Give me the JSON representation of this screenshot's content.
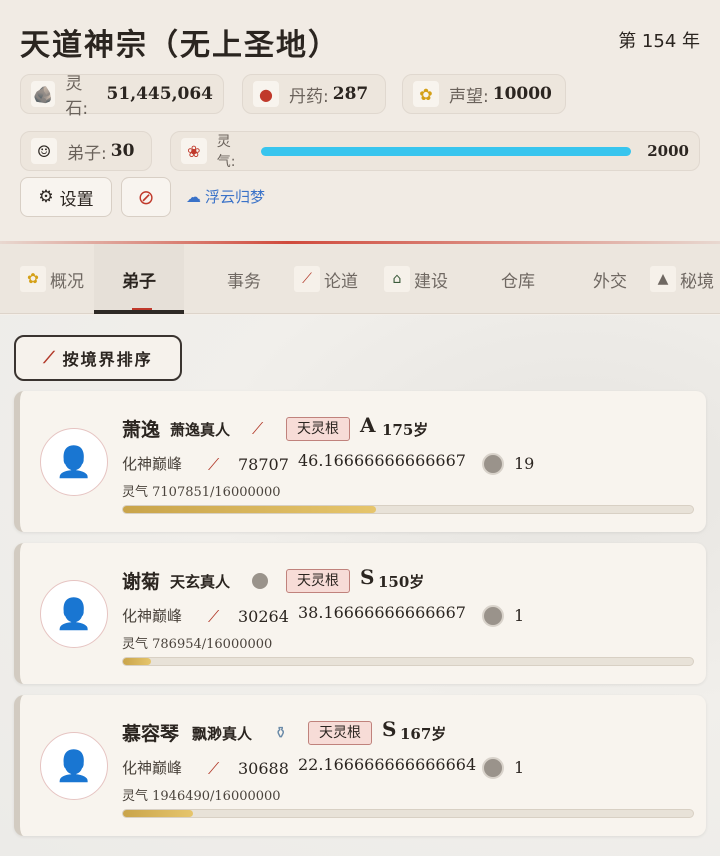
{
  "header": {
    "title": "天道神宗（无上圣地）",
    "year": "第 154 年",
    "stats": [
      {
        "label": "灵石:",
        "value": "51,445,064",
        "icon": "spirit-stone-icon"
      },
      {
        "label": "丹药:",
        "value": "287",
        "icon": "gourd-icon"
      },
      {
        "label": "声望:",
        "value": "10000",
        "icon": "reputation-icon"
      },
      {
        "label": "弟子:",
        "value": "30",
        "icon": "disciple-icon"
      }
    ],
    "qi": {
      "label": "灵气:",
      "value": "2000",
      "fill": 1.0,
      "color": "#38c5ee"
    },
    "settings_label": "设置",
    "music_name": "浮云归梦"
  },
  "tabs": [
    {
      "label": "概况",
      "icon": "overview-icon",
      "active": false
    },
    {
      "label": "弟子",
      "icon": "",
      "active": true
    },
    {
      "label": "事务",
      "icon": "",
      "active": false
    },
    {
      "label": "论道",
      "icon": "sword-icon",
      "active": false
    },
    {
      "label": "建设",
      "icon": "pavilion-icon",
      "active": false
    },
    {
      "label": "仓库",
      "icon": "",
      "active": false
    },
    {
      "label": "外交",
      "icon": "",
      "active": false
    },
    {
      "label": "秘境",
      "icon": "mountain-icon",
      "active": false
    }
  ],
  "sort_label": "按境界排序",
  "disciples": [
    {
      "name": "萧逸",
      "dao": "萧逸真人",
      "weapon_icon": "sword-icon",
      "root": "天灵根",
      "grade": "A",
      "age": "175岁",
      "realm": "化神巅峰",
      "power": "78707",
      "speed": "46.16666666666667",
      "count": "19",
      "qi": "灵气 7107851/16000000",
      "progress": 0.444
    },
    {
      "name": "谢菊",
      "dao": "天玄真人",
      "weapon_icon": "disc-icon",
      "root": "天灵根",
      "grade": "S",
      "age": "150岁",
      "realm": "化神巅峰",
      "power": "30264",
      "speed": "38.16666666666667",
      "count": "1",
      "qi": "灵气 786954/16000000",
      "progress": 0.049
    },
    {
      "name": "慕容琴",
      "dao": "飘渺真人",
      "weapon_icon": "vase-icon",
      "root": "天灵根",
      "grade": "S",
      "age": "167岁",
      "realm": "化神巅峰",
      "power": "30688",
      "speed": "22.166666666666664",
      "count": "1",
      "qi": "灵气 1946490/16000000",
      "progress": 0.122
    }
  ]
}
